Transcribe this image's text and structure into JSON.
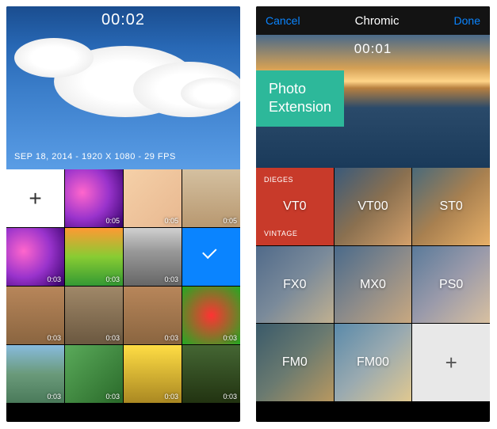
{
  "left": {
    "timer": "00:02",
    "meta": "SEP 18, 2014 - 1920 X 1080 - 29 FPS",
    "add_label": "+",
    "thumbs": [
      {
        "dur": "0:05"
      },
      {
        "dur": "0:05"
      },
      {
        "dur": "0:05"
      },
      {
        "dur": "0:03"
      },
      {
        "dur": "0:03"
      },
      {
        "dur": "0:03"
      },
      {
        "dur": "0:03"
      },
      {
        "dur": "0:03"
      },
      {
        "dur": "0:03"
      },
      {
        "dur": "0:03"
      },
      {
        "dur": "0:03"
      },
      {
        "dur": "0:03"
      },
      {
        "dur": "0:03"
      },
      {
        "dur": "0:03"
      }
    ]
  },
  "right": {
    "nav": {
      "cancel": "Cancel",
      "title": "Chromic",
      "done": "Done"
    },
    "timer": "00:01",
    "badge_line1": "Photo",
    "badge_line2": "Extension",
    "active": {
      "tag_top": "DIEGES",
      "label": "VT0",
      "tag_bot": "VINTAGE"
    },
    "filters": [
      "VT00",
      "ST0",
      "FX0",
      "MX0",
      "PS0",
      "FM0",
      "FM00"
    ],
    "add_label": "+"
  }
}
